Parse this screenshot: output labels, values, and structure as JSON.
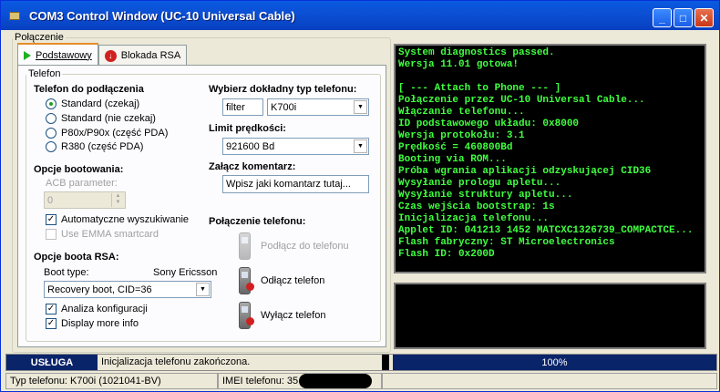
{
  "window": {
    "title": "COM3 Control Window (UC-10 Universal Cable)",
    "min": "_",
    "max": "□",
    "close": "✕"
  },
  "connection": {
    "legend": "Połączenie",
    "tabs": [
      {
        "label": "Podstawowy"
      },
      {
        "label": "Blokada RSA"
      }
    ]
  },
  "phone": {
    "legend": "Telefon",
    "connect_heading": "Telefon do podłączenia",
    "radios": [
      {
        "label": "Standard (czekaj)",
        "checked": true
      },
      {
        "label": "Standard (nie czekaj)",
        "checked": false
      },
      {
        "label": "P80x/P90x (część PDA)",
        "checked": false
      },
      {
        "label": "R380 (część PDA)",
        "checked": false
      }
    ],
    "boot_heading": "Opcje bootowania:",
    "acb_label": "ACB parameter:",
    "acb_value": "0",
    "auto_search": "Automatyczne wyszukiwanie",
    "use_emma": "Use EMMA smartcard",
    "rsa_heading": "Opcje boota RSA:",
    "boot_type_label": "Boot type:",
    "boot_type_value": "Sony Ericsson",
    "boot_select": "Recovery boot, CID=36",
    "analyze": "Analiza konfiguracji",
    "display_more": "Display more info",
    "type_heading": "Wybierz dokładny typ telefonu:",
    "filter": "filter",
    "model": "K700i",
    "speed_heading": "Limit prędkości:",
    "speed": "921600 Bd",
    "comment_heading": "Załącz komentarz:",
    "comment_placeholder": "Wpisz jaki komantarz tutaj...",
    "phone_conn_heading": "Połączenie telefonu:",
    "connect_btn": "Podłącz do telefonu",
    "disconnect_btn": "Odłącz telefon",
    "poweroff_btn": "Wyłącz telefon"
  },
  "log": [
    "System diagnostics passed.",
    "Wersja 11.01 gotowa!",
    "",
    "[ --- Attach to Phone --- ]",
    "Połączenie przez UC-10 Universal Cable...",
    "Włączanie telefonu...",
    "ID podstawowego układu: 0x8000",
    "Wersja protokołu: 3.1",
    "Prędkość = 460800Bd",
    "Booting via ROM...",
    "Próba wgrania aplikacji odzyskującej CID36",
    "Wysyłanie prologu apletu...",
    "Wysyłanie struktury apletu...",
    "Czas wejścia bootstrap: 1s",
    "Inicjalizacja telefonu...",
    "Applet ID: 041213 1452 MATCXC1326739_COMPACTCE...",
    "Flash fabryczny: ST Microelectronics",
    "Flash ID: 0x200D"
  ],
  "status": {
    "service": "USŁUGA",
    "message": "Inicjalizacja telefonu zakończona.",
    "progress_text": "100%",
    "progress": 1.0,
    "phone_type": "Typ telefonu: K700i (1021041-BV)",
    "imei": "IMEI telefonu: 35"
  }
}
